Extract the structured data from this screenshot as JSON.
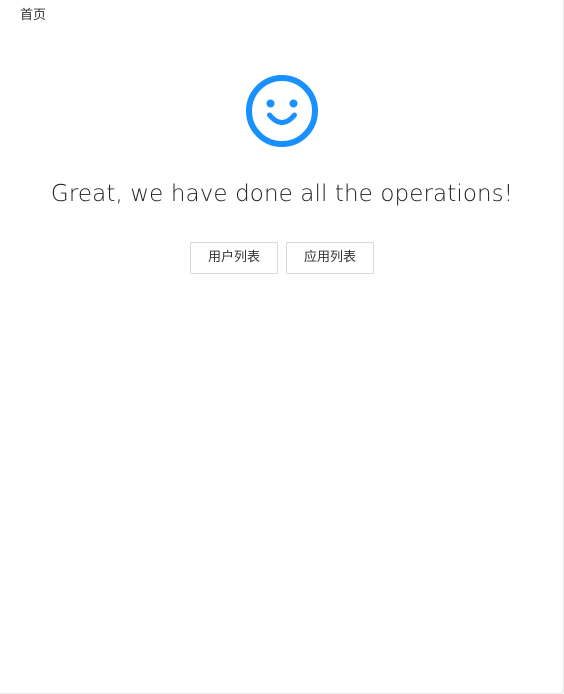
{
  "breadcrumb": {
    "home_label": "首页"
  },
  "result": {
    "icon": "smile-icon",
    "icon_color": "#1890ff",
    "title": "Great, we have done all the operations!"
  },
  "actions": {
    "user_list_label": "用户列表",
    "app_list_label": "应用列表"
  }
}
